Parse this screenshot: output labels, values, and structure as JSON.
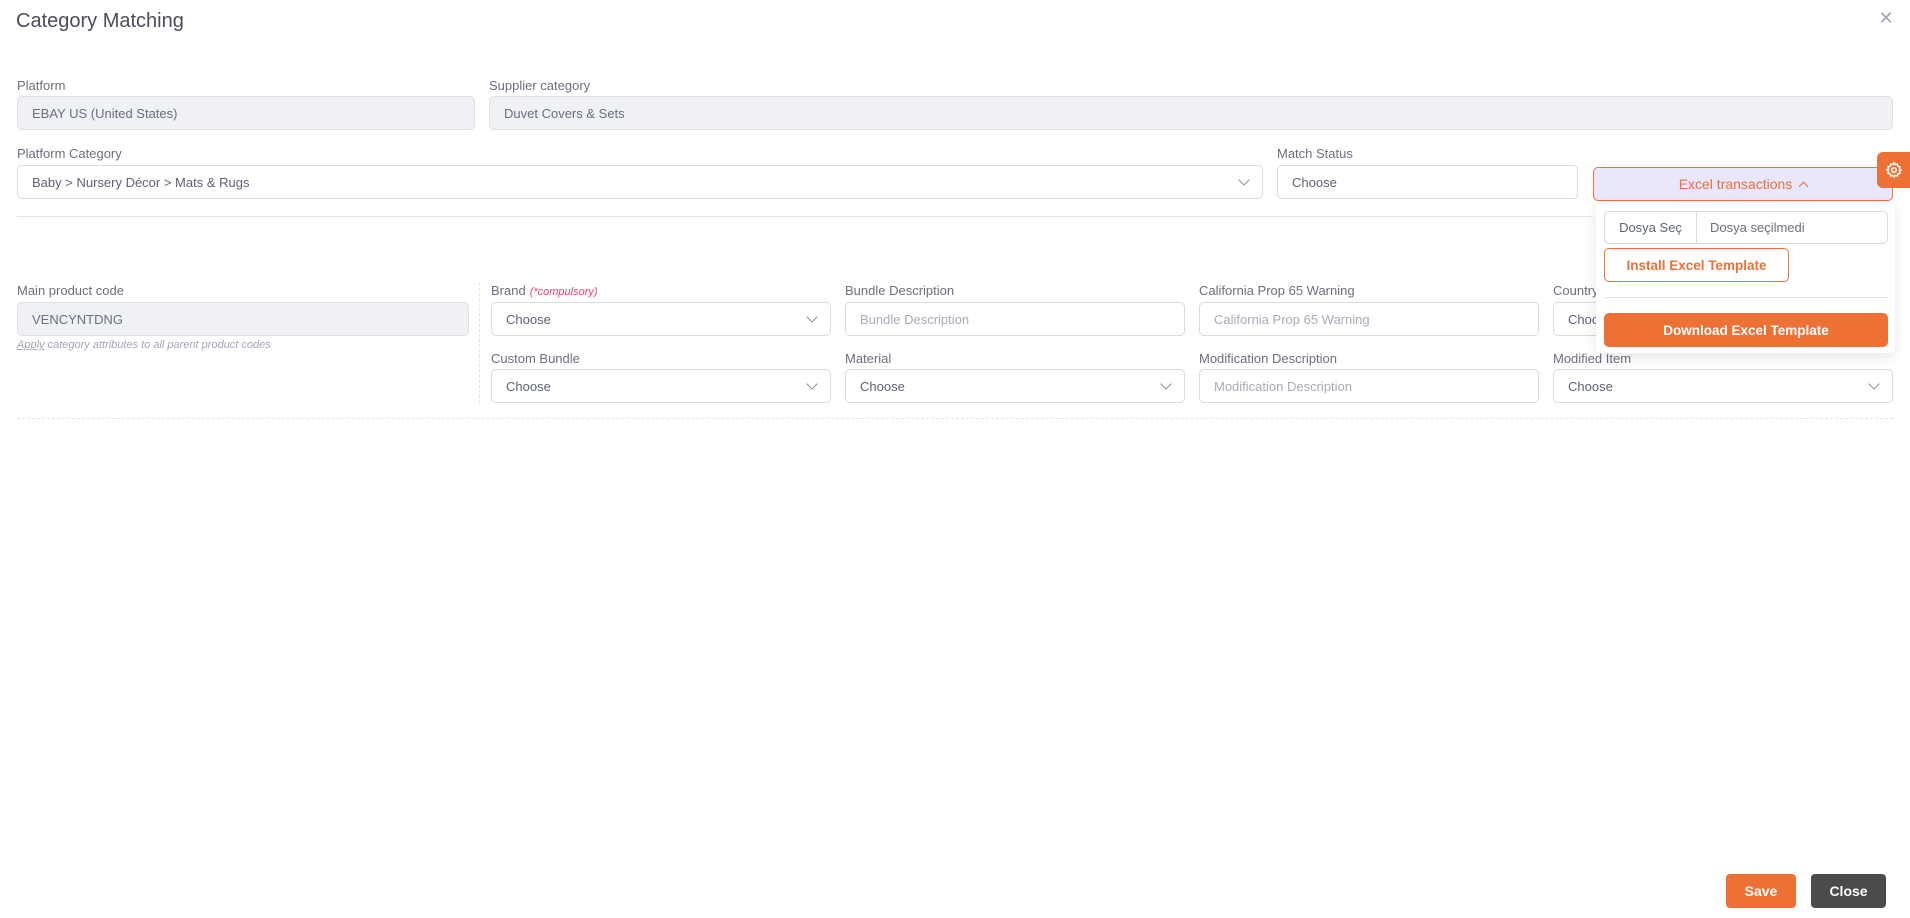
{
  "modal": {
    "title": "Category Matching",
    "close_icon": "close-icon"
  },
  "fields": {
    "platform": {
      "label": "Platform",
      "value": "EBAY US (United States)"
    },
    "supplier_category": {
      "label": "Supplier category",
      "value": "Duvet Covers & Sets"
    },
    "platform_category": {
      "label": "Platform Category",
      "value": "Baby > Nursery Décor > Mats & Rugs"
    },
    "match_status": {
      "label": "Match Status",
      "value": "Choose"
    }
  },
  "excel": {
    "toggle_label": "Excel transactions",
    "toggle_icon": "chevron-up-icon",
    "file_button": "Dosya Seç",
    "file_status": "Dosya seçilmedi",
    "install_label": "Install Excel Template",
    "download_label": "Download Excel Template"
  },
  "settings_tab": {
    "icon": "gear-icon"
  },
  "product": {
    "main_code_label": "Main product code",
    "main_code_value": "VENCYNTDNG",
    "apply_link": "Apply",
    "apply_text": " category attributes to all parent product codes"
  },
  "attributes": [
    {
      "label": "Brand",
      "required_note": "(*compulsory)",
      "type": "select",
      "value": "Choose"
    },
    {
      "label": "Bundle Description",
      "type": "text",
      "placeholder": "Bundle Description"
    },
    {
      "label": "California Prop 65 Warning",
      "type": "text",
      "placeholder": "California Prop 65 Warning"
    },
    {
      "label": "Country",
      "type": "select",
      "value": "Choose"
    },
    {
      "label": "Custom Bundle",
      "type": "select",
      "value": "Choose"
    },
    {
      "label": "Material",
      "type": "select",
      "value": "Choose"
    },
    {
      "label": "Modification Description",
      "type": "text",
      "placeholder": "Modification Description"
    },
    {
      "label": "Modified Item",
      "type": "select",
      "value": "Choose"
    }
  ],
  "footer": {
    "save_label": "Save",
    "close_label": "Close"
  },
  "colors": {
    "accent": "#ed7035",
    "dark_button": "#4b4b4b",
    "excel_toggle_bg": "#e8e7fb",
    "required": "#f1416c"
  }
}
